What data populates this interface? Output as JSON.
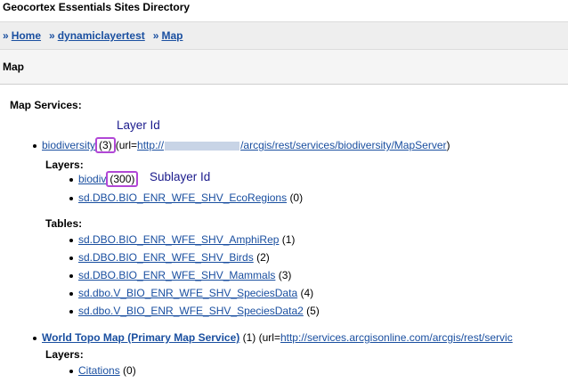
{
  "app": {
    "title": "Geocortex Essentials Sites Directory"
  },
  "breadcrumb": {
    "separator": "»",
    "items": [
      "Home",
      "dynamiclayertest",
      "Map"
    ]
  },
  "page": {
    "title": "Map",
    "section_title": "Map Services:"
  },
  "annotations": {
    "layer_id": "Layer Id",
    "sublayer_id": "Sublayer Id"
  },
  "services": [
    {
      "name": "biodiversity",
      "id": "(3)",
      "url_prefix": "(url=",
      "url_start": "http://",
      "url_end": "/arcgis/rest/services/biodiversity/MapServer",
      "url_close": ")",
      "layers_label": "Layers:",
      "layers": [
        {
          "name": "biodiv",
          "id": "(300)"
        },
        {
          "name": "sd.DBO.BIO_ENR_WFE_SHV_EcoRegions",
          "id": "(0)"
        }
      ],
      "tables_label": "Tables:",
      "tables": [
        {
          "name": "sd.DBO.BIO_ENR_WFE_SHV_AmphiRep",
          "id": "(1)"
        },
        {
          "name": "sd.DBO.BIO_ENR_WFE_SHV_Birds",
          "id": "(2)"
        },
        {
          "name": "sd.DBO.BIO_ENR_WFE_SHV_Mammals",
          "id": "(3)"
        },
        {
          "name": "sd.dbo.V_BIO_ENR_WFE_SHV_SpeciesData",
          "id": "(4)"
        },
        {
          "name": "sd.dbo.V_BIO_ENR_WFE_SHV_SpeciesData2",
          "id": "(5)"
        }
      ]
    },
    {
      "name": "World Topo Map (Primary Map Service)",
      "id": "(1)",
      "url_prefix": "(url=",
      "url": "http://services.arcgisonline.com/arcgis/rest/servic",
      "layers_label": "Layers:",
      "layers": [
        {
          "name": "Citations",
          "id": "(0)"
        }
      ]
    }
  ],
  "colors": {
    "link": "#1a4fa0",
    "highlight": "#b147d6",
    "annotation": "#1a1a8c"
  }
}
